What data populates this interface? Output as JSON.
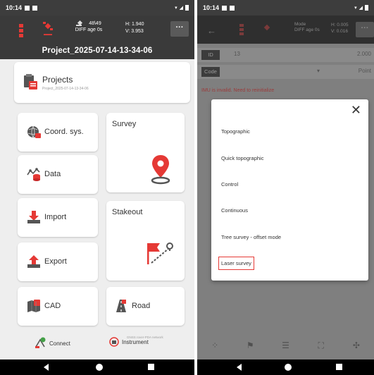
{
  "left": {
    "status": {
      "time": "10:14"
    },
    "topbar": {
      "solution_line1": "48\\49",
      "solution_line2": "DIFF age 0s",
      "h": "H: 1.940",
      "v": "V: 3.953",
      "menu": "···",
      "project_name": "Project_2025-07-14-13-34-06"
    },
    "projects": {
      "title": "Projects",
      "subtitle": "Project_2025-07-14-13-34-06"
    },
    "tiles": {
      "coord": "Coord. sys.",
      "data": "Data",
      "import": "Import",
      "export": "Export",
      "cad": "CAD",
      "survey": "Survey",
      "stakeout": "Stakeout",
      "road": "Road"
    },
    "bottom": {
      "connect": "Connect",
      "instrument": "Instrument",
      "gnss_hint": "GNSS rover-PDA network"
    }
  },
  "right": {
    "status": {
      "time": "10:14"
    },
    "topbar": {
      "mode1": "Mode",
      "mode2": "DIFF age 0s",
      "h": "H: 0.005",
      "v": "V: 0.016",
      "menu": "···"
    },
    "row_id": {
      "tag": "ID",
      "value": "13",
      "right": "2.000"
    },
    "row_code": {
      "tag": "Code",
      "right": "Point"
    },
    "error": "IMU is invalid. Need to reinitialize",
    "modal": {
      "close": "✕",
      "options": [
        "Topographic",
        "Quick topographic",
        "Control",
        "Continuous",
        "Tree survey - offset mode",
        "Laser survey"
      ]
    }
  },
  "colors": {
    "accent_red": "#e53935",
    "topbar": "#3a3a3a"
  }
}
